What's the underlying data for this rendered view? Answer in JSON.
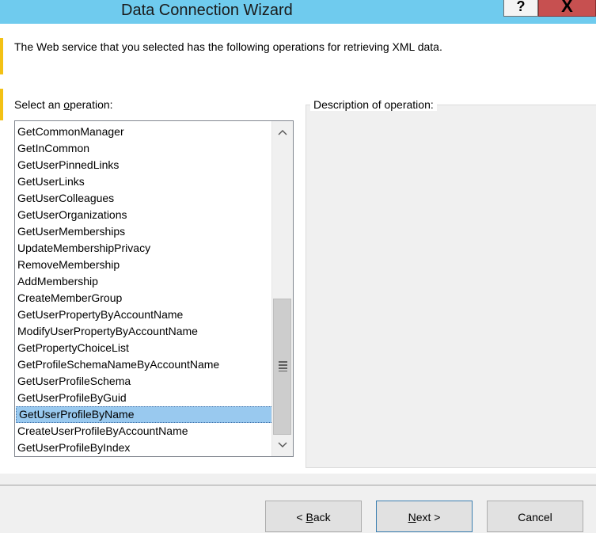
{
  "window": {
    "title": "Data Connection Wizard",
    "help_glyph": "?",
    "close_glyph": "X"
  },
  "intro": {
    "text": "The Web service that you selected has the following operations for retrieving XML data."
  },
  "operations": {
    "label_prefix": "Select an ",
    "label_mnemonic": "o",
    "label_suffix": "peration:",
    "items": [
      "GetCommonManager",
      "GetInCommon",
      "GetUserPinnedLinks",
      "GetUserLinks",
      "GetUserColleagues",
      "GetUserOrganizations",
      "GetUserMemberships",
      "UpdateMembershipPrivacy",
      "RemoveMembership",
      "AddMembership",
      "CreateMemberGroup",
      "GetUserPropertyByAccountName",
      "ModifyUserPropertyByAccountName",
      "GetPropertyChoiceList",
      "GetProfileSchemaNameByAccountName",
      "GetUserProfileSchema",
      "GetUserProfileByGuid",
      "GetUserProfileByName",
      "CreateUserProfileByAccountName",
      "GetUserProfileByIndex"
    ],
    "selected": "GetUserProfileByName",
    "scroll_up_glyph": "︿",
    "scroll_down_glyph": "﹀"
  },
  "description": {
    "label": "Description of operation:"
  },
  "buttons": {
    "back_prefix": "< ",
    "back_mnemonic": "B",
    "back_suffix": "ack",
    "next_mnemonic": "N",
    "next_suffix": "ext >",
    "cancel": "Cancel"
  },
  "colors": {
    "titlebar": "#6fcbee",
    "accent": "#f3c114",
    "selection": "#99c9ef",
    "close": "#c75050"
  }
}
